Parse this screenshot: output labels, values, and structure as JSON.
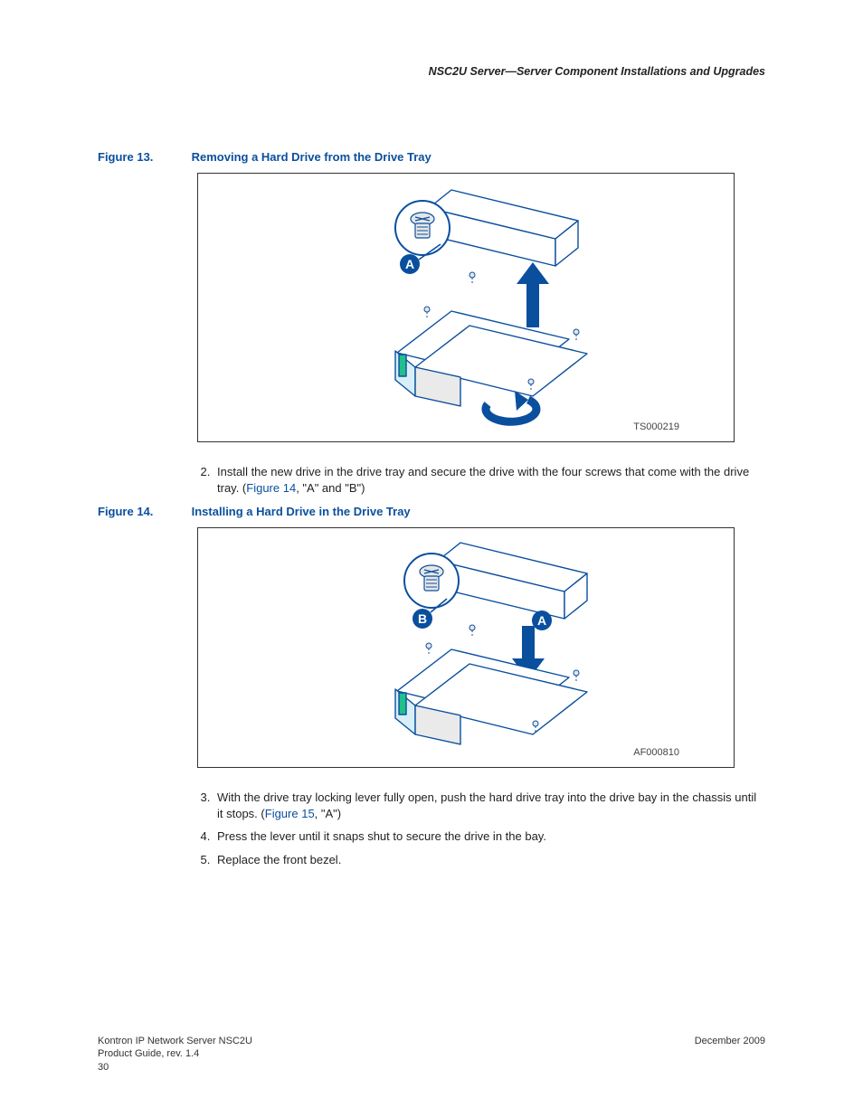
{
  "header": {
    "running": "NSC2U Server—Server Component Installations and Upgrades"
  },
  "figures": {
    "f13": {
      "num": "Figure 13.",
      "title": "Removing a Hard Drive from the Drive Tray",
      "code": "TS000219",
      "callout_a": "A"
    },
    "f14": {
      "num": "Figure 14.",
      "title": "Installing a Hard Drive in the Drive Tray",
      "code": "AF000810",
      "callout_a": "A",
      "callout_b": "B"
    }
  },
  "steps": {
    "s2a": "Install the new drive in the drive tray and secure the drive with the four screws that come with the drive tray. (",
    "s2_link": "Figure 14",
    "s2b": ", \"A\" and \"B\")",
    "s3a": "With the drive tray locking lever fully open, push the hard drive tray into the drive bay in the chassis until it stops. (",
    "s3_link": "Figure 15",
    "s3b": ", \"A\")",
    "s4": "Press the lever until it snaps shut to secure the drive in the bay.",
    "s5": "Replace the front bezel."
  },
  "footer": {
    "line1": "Kontron IP Network Server NSC2U",
    "line2": "Product Guide, rev. 1.4",
    "page": "30",
    "date": "December 2009"
  }
}
